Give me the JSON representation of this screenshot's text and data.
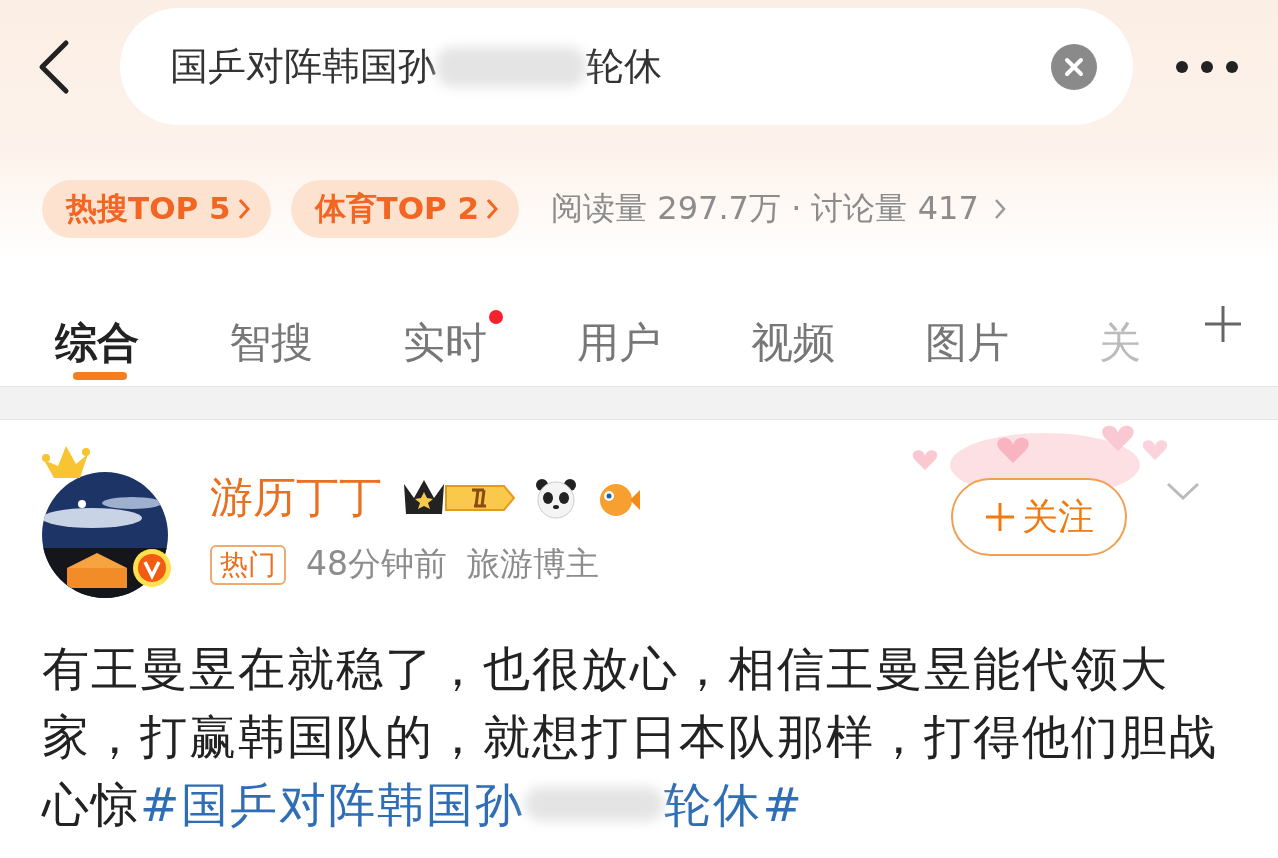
{
  "search": {
    "query_before_blur": "国乒对阵韩国孙",
    "query_after_blur": "轮休"
  },
  "rank_badges": [
    {
      "label": "热搜TOP 5"
    },
    {
      "label": "体育TOP 2"
    }
  ],
  "stats": "阅读量 297.7万 · 讨论量 417",
  "tabs": [
    {
      "label": "综合",
      "selected": true,
      "dot": false
    },
    {
      "label": "智搜",
      "selected": false,
      "dot": false
    },
    {
      "label": "实时",
      "selected": false,
      "dot": true
    },
    {
      "label": "用户",
      "selected": false,
      "dot": false
    },
    {
      "label": "视频",
      "selected": false,
      "dot": false
    },
    {
      "label": "图片",
      "selected": false,
      "dot": false
    },
    {
      "label": "关",
      "selected": false,
      "dot": false
    }
  ],
  "post": {
    "author": "游历丁丁",
    "verified": true,
    "tag": "热门",
    "time": "48分钟前",
    "role": "旅游博主",
    "follow_label": "关注",
    "body": "有王曼昱在就稳了，也很放心，相信王曼昱能代领大家，打赢韩国队的，就想打日本队那样，打得他们胆战心惊",
    "hashtag_before_blur": "#国乒对阵韩国孙",
    "hashtag_after_blur": "轮休#"
  }
}
